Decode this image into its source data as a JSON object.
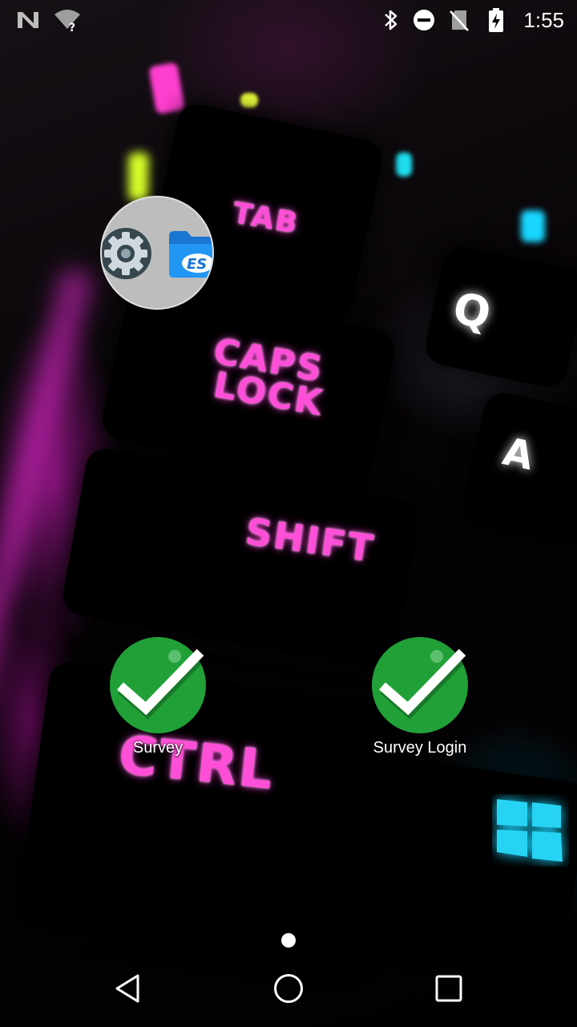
{
  "status_bar": {
    "time": "1:55",
    "icons": [
      "notification-n-icon",
      "wifi-unknown-icon",
      "bluetooth-icon",
      "do-not-disturb-icon",
      "no-sim-icon",
      "battery-charging-icon"
    ]
  },
  "wallpaper": {
    "keys": {
      "tab": "TAB",
      "caps_line1": "CAPS",
      "caps_line2": "LOCK",
      "shift": "SHIFT",
      "ctrl": "CTRL",
      "q": "Q",
      "a": "A"
    }
  },
  "home": {
    "folder": {
      "apps": [
        "settings-icon",
        "es-file-explorer-icon"
      ]
    },
    "apps": [
      {
        "label": "Survey",
        "icon": "check-circle-icon"
      },
      {
        "label": "Survey Login",
        "icon": "check-circle-icon"
      }
    ]
  },
  "nav_bar": {
    "buttons": [
      "back-icon",
      "home-icon",
      "recents-icon"
    ]
  },
  "colors": {
    "neon_pink": "#ff4fd8",
    "check_green": "#21a038",
    "folder_bg": "#bdbdbd"
  }
}
